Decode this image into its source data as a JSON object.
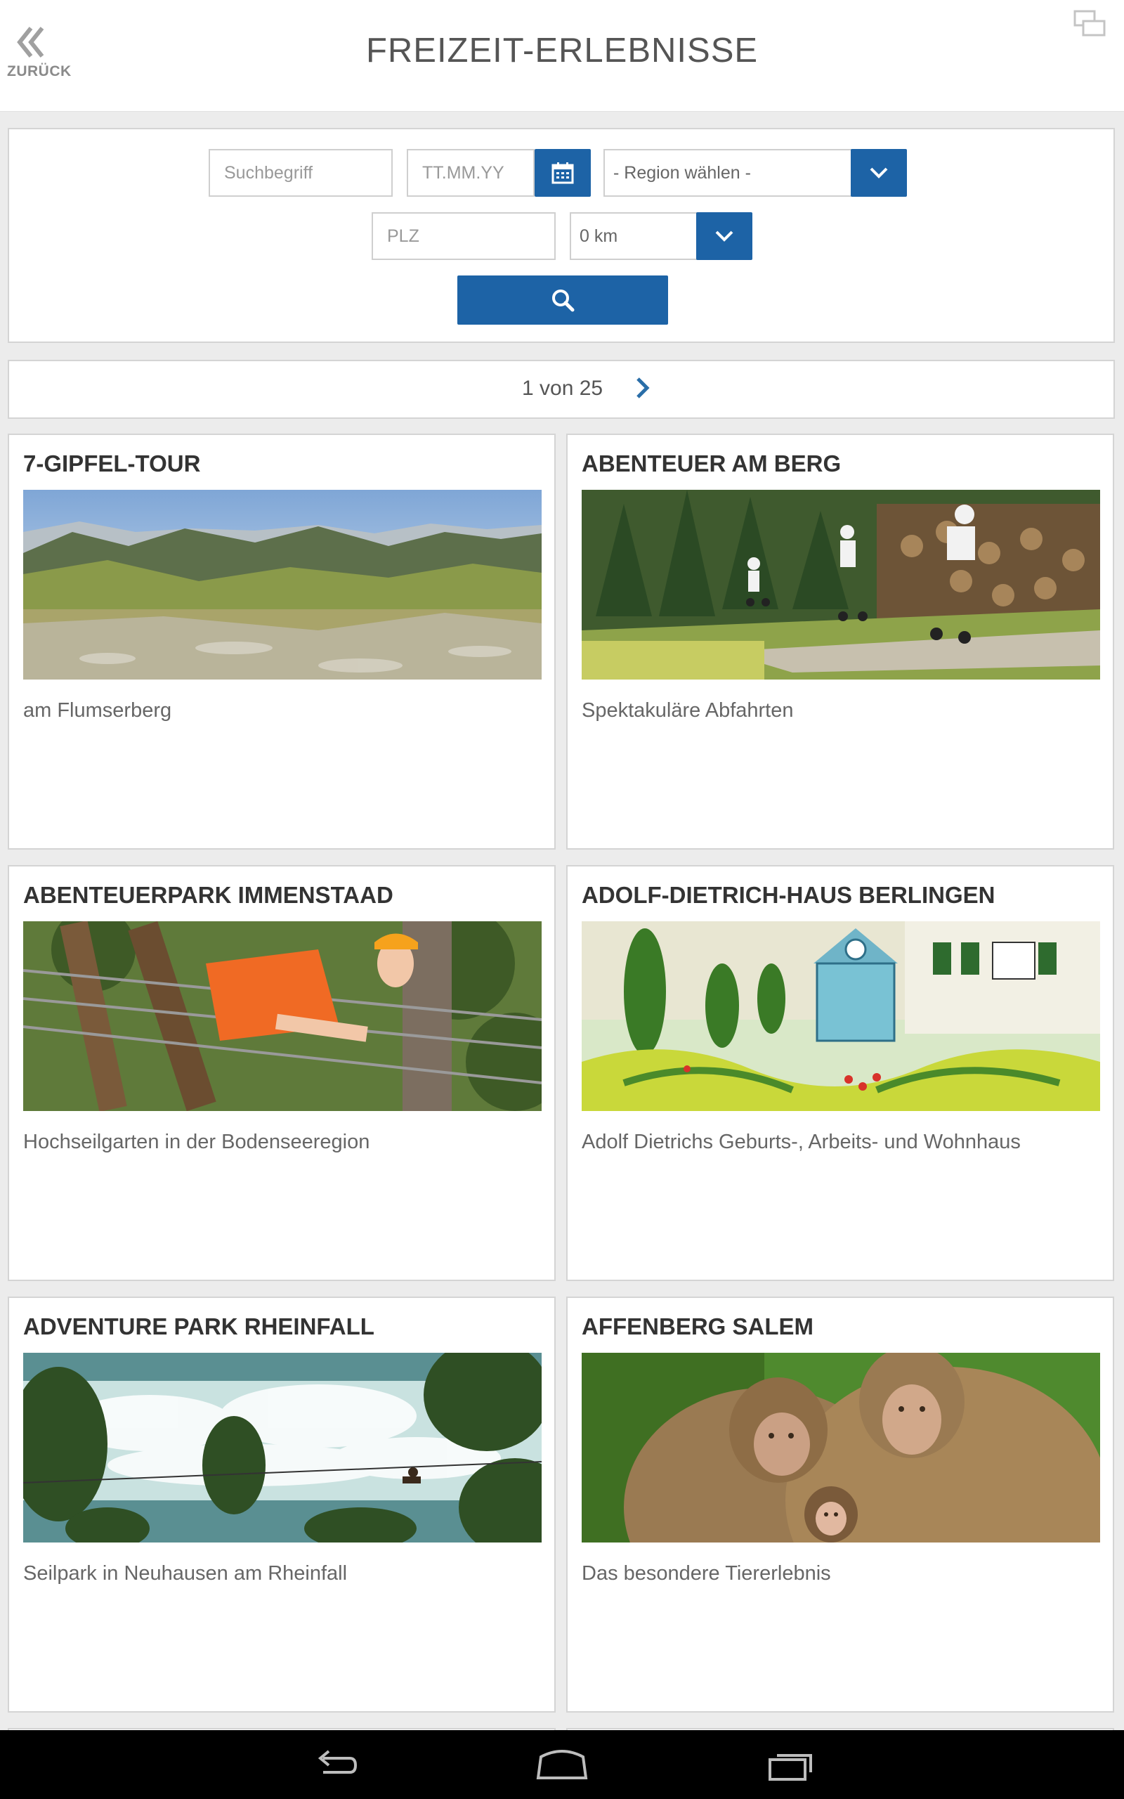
{
  "header": {
    "back_label": "ZURÜCK",
    "title": "FREIZEIT-ERLEBNISSE"
  },
  "search": {
    "keyword_placeholder": "Suchbegriff",
    "date_placeholder": "TT.MM.YY",
    "region_value": "- Region wählen -",
    "plz_placeholder": "PLZ",
    "distance_value": "0 km"
  },
  "pager": {
    "text": "1 von 25"
  },
  "cards": [
    {
      "title": "7-GIPFEL-TOUR",
      "description": "am Flumserberg"
    },
    {
      "title": "ABENTEUER AM BERG",
      "description": "Spektakuläre Abfahrten"
    },
    {
      "title": "ABENTEUERPARK IMMENSTAAD",
      "description": "Hochseilgarten in der Bodenseeregion"
    },
    {
      "title": "ADOLF-DIETRICH-HAUS BERLINGEN",
      "description": "Adolf Dietrichs Geburts-, Arbeits- und Wohnhaus"
    },
    {
      "title": "ADVENTURE PARK RHEINFALL",
      "description": "Seilpark in Neuhausen am Rheinfall"
    },
    {
      "title": "AFFENBERG SALEM",
      "description": "Das besondere Tiererlebnis"
    }
  ],
  "colors": {
    "accent": "#1d63a6",
    "background": "#ececec"
  },
  "icons": [
    "double-chevron-left-icon",
    "window-icon",
    "calendar-icon",
    "chevron-down-icon",
    "search-icon",
    "chevron-right-icon",
    "back-nav-icon",
    "home-nav-icon",
    "recents-nav-icon"
  ]
}
